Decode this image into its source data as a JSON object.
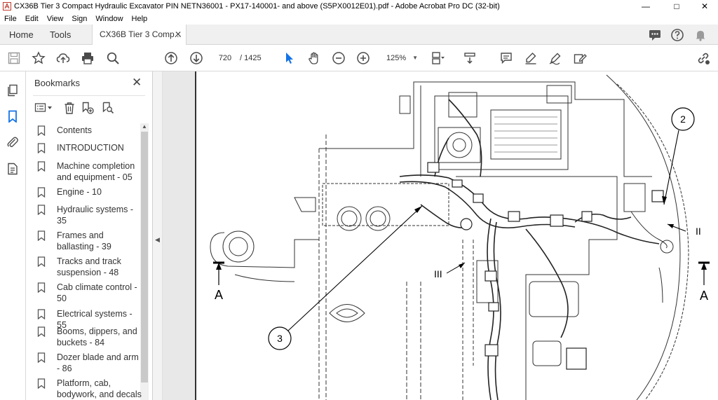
{
  "window": {
    "title": "CX36B Tier 3 Compact Hydraulic Excavator PIN NETN36001 - PX17-140001- and above (S5PX0012E01).pdf - Adobe Acrobat Pro DC (32-bit)",
    "minimize": "—",
    "maximize": "□",
    "close": "✕"
  },
  "menu": [
    "File",
    "Edit",
    "View",
    "Sign",
    "Window",
    "Help"
  ],
  "tabs": {
    "home": "Home",
    "tools": "Tools",
    "document": "CX36B Tier 3 Comp...",
    "document_close": "✕"
  },
  "toolbar": {
    "page_current": "720",
    "page_total": "/ 1425",
    "zoom": "125%",
    "zoom_dropdown": "▼"
  },
  "bookmarks": {
    "title": "Bookmarks",
    "close": "✕",
    "items": [
      "Contents",
      "INTRODUCTION",
      "Machine completion and equipment - 05",
      "Engine - 10",
      "Hydraulic systems - 35",
      "Frames and ballasting - 39",
      "Tracks and track suspension - 48",
      "Cab climate control - 50",
      "Electrical systems - 55",
      "Booms, dippers, and buckets - 84",
      "Dozer blade and arm - 86",
      "Platform, cab, bodywork, and decals"
    ],
    "scroll_up": "▲"
  },
  "collapse_arrow": "◀",
  "drawing": {
    "callout_2": "2",
    "callout_3": "3",
    "section_left": "A",
    "section_right": "A",
    "roman_right": "II",
    "roman_center": "III"
  },
  "colors": {
    "accent": "#1473e6",
    "tab_bg": "#f0f0f0",
    "icon_gray": "#4b4b4b"
  }
}
